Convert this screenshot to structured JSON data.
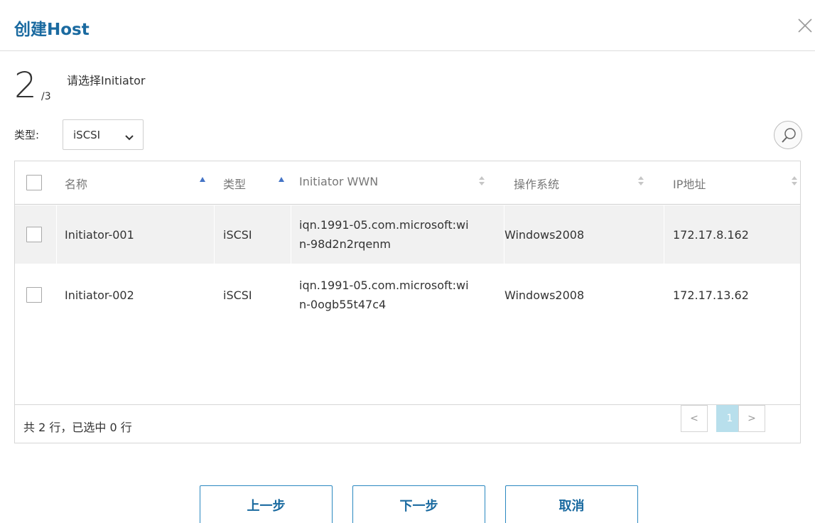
{
  "dialog": {
    "title": "创建Host",
    "close_icon": "close-icon"
  },
  "step": {
    "current": "2",
    "total": "/3",
    "label": "请选择Initiator"
  },
  "filter": {
    "type_label": "类型:",
    "type_value": "iSCSI"
  },
  "table": {
    "columns": [
      "名称",
      "类型",
      "Initiator WWN",
      "操作系统",
      "IP地址"
    ],
    "rows": [
      {
        "name": "Initiator-001",
        "type": "iSCSI",
        "wwn_line1": "iqn.1991-05.com.microsoft:wi",
        "wwn_line2": "n-98d2n2rqenm",
        "os": "Windows2008",
        "ip": "172.17.8.162"
      },
      {
        "name": "Initiator-002",
        "type": "iSCSI",
        "wwn_line1": "iqn.1991-05.com.microsoft:wi",
        "wwn_line2": "n-0ogb55t47c4",
        "os": "Windows2008",
        "ip": "172.17.13.62"
      }
    ],
    "footer_count": "共 2 行，已选中 0 行",
    "pager": {
      "prev": "<",
      "current": "1",
      "next": ">"
    }
  },
  "buttons": {
    "prev": "上一步",
    "next": "下一步",
    "cancel": "取消"
  },
  "colors": {
    "title": "#1a6aa0",
    "accent": "#2a88c0",
    "sort_active": "#4474c6",
    "row_alt": "#f1f1f1",
    "page_current": "#b8dfec"
  }
}
